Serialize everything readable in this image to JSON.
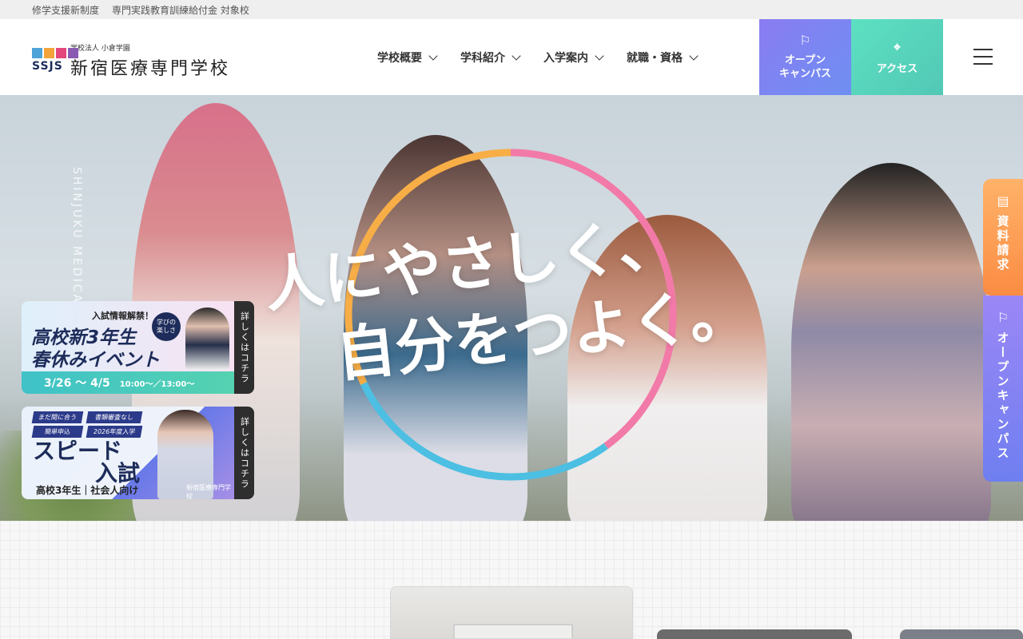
{
  "topbar": {
    "items": [
      "修学支援新制度",
      "専門実践教育訓練給付金 対象校"
    ]
  },
  "header": {
    "logo_letters": "SSJS",
    "logo_sub": "学校法人 小倉学園",
    "logo_main": "新宿医療専門学校",
    "nav": [
      {
        "label": "学校概要"
      },
      {
        "label": "学科紹介"
      },
      {
        "label": "入学案内"
      },
      {
        "label": "就職・資格"
      }
    ],
    "open_campus": "オープン\nキャンパス",
    "access": "アクセス"
  },
  "hero": {
    "vertical_tag": "SHINJUKU MEDICAL",
    "copy_line1": "人にやさしく、",
    "copy_line2": "自分をつよく。",
    "ring_colors": [
      "#f7ae46",
      "#f27aa8",
      "#4cbfe2"
    ]
  },
  "banners": [
    {
      "tag": "入試情報解禁！",
      "title1": "高校新3年生",
      "title2": "春休みイベント",
      "date": "3/26 〜 4/5",
      "time": "10:00〜／13:00〜",
      "badge": "学びの\n楽しさ",
      "side": "詳しくはコチラ"
    },
    {
      "pills": [
        "まだ間に合う",
        "書類審査なし",
        "簡単申込",
        "2026年度入学"
      ],
      "title1": "スピード",
      "title2": "入試",
      "foot": "高校3年生｜社会人向け",
      "school": "新宿医療専門学校",
      "side": "詳しくはコチラ"
    }
  ],
  "side_tabs": {
    "doc_request": "資料請求",
    "open_campus": "オープンキャンパス"
  },
  "colors": {
    "open_campus_btn": "#7f86f2",
    "access_btn": "#58d6bd",
    "doc_tab": "#fc9a50"
  }
}
